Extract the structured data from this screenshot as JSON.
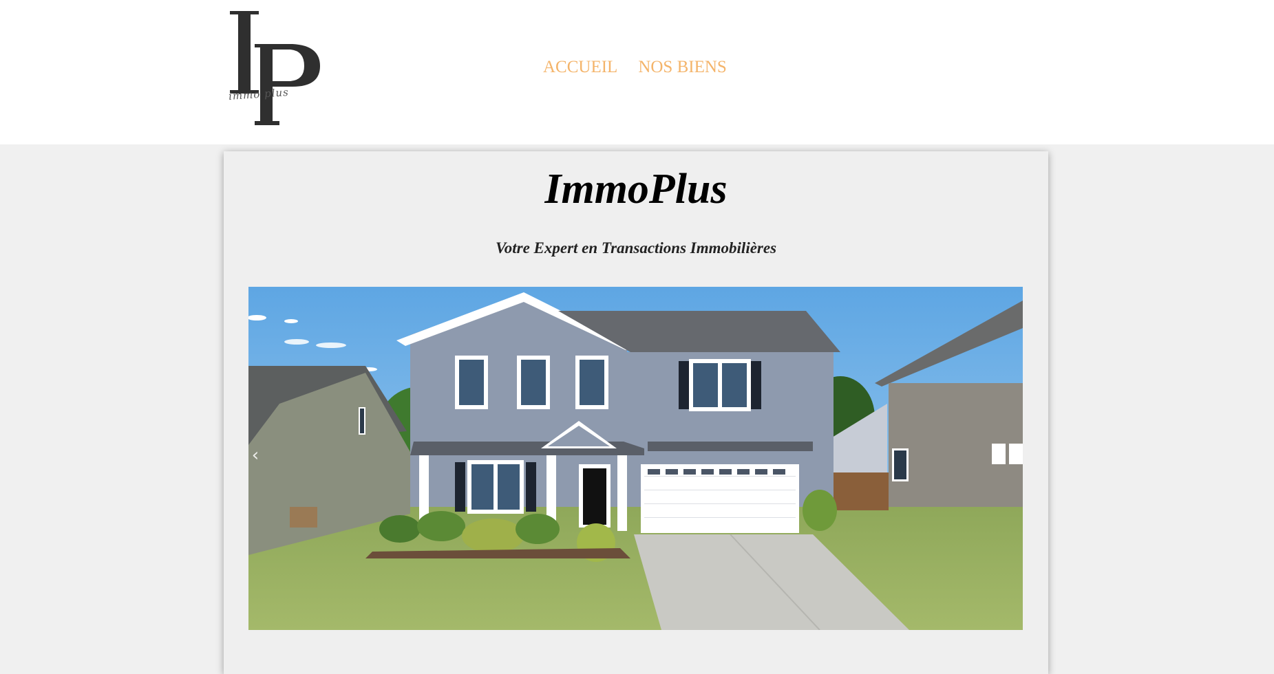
{
  "header": {
    "logo": {
      "monogram": "IP",
      "script_text": "immo plus"
    },
    "nav": [
      {
        "label": "ACCUEIL"
      },
      {
        "label": "NOS BIENS"
      }
    ],
    "nav_color": "#f4b46a"
  },
  "hero": {
    "title": "ImmoPlus",
    "subtitle": "Votre Expert en Transactions Immobilières"
  },
  "carousel": {
    "image_description_icon": "house-photo",
    "prev_icon": "chevron-left-icon",
    "next_icon": "chevron-right-icon",
    "prev_glyph": "‹",
    "next_glyph": "›"
  }
}
